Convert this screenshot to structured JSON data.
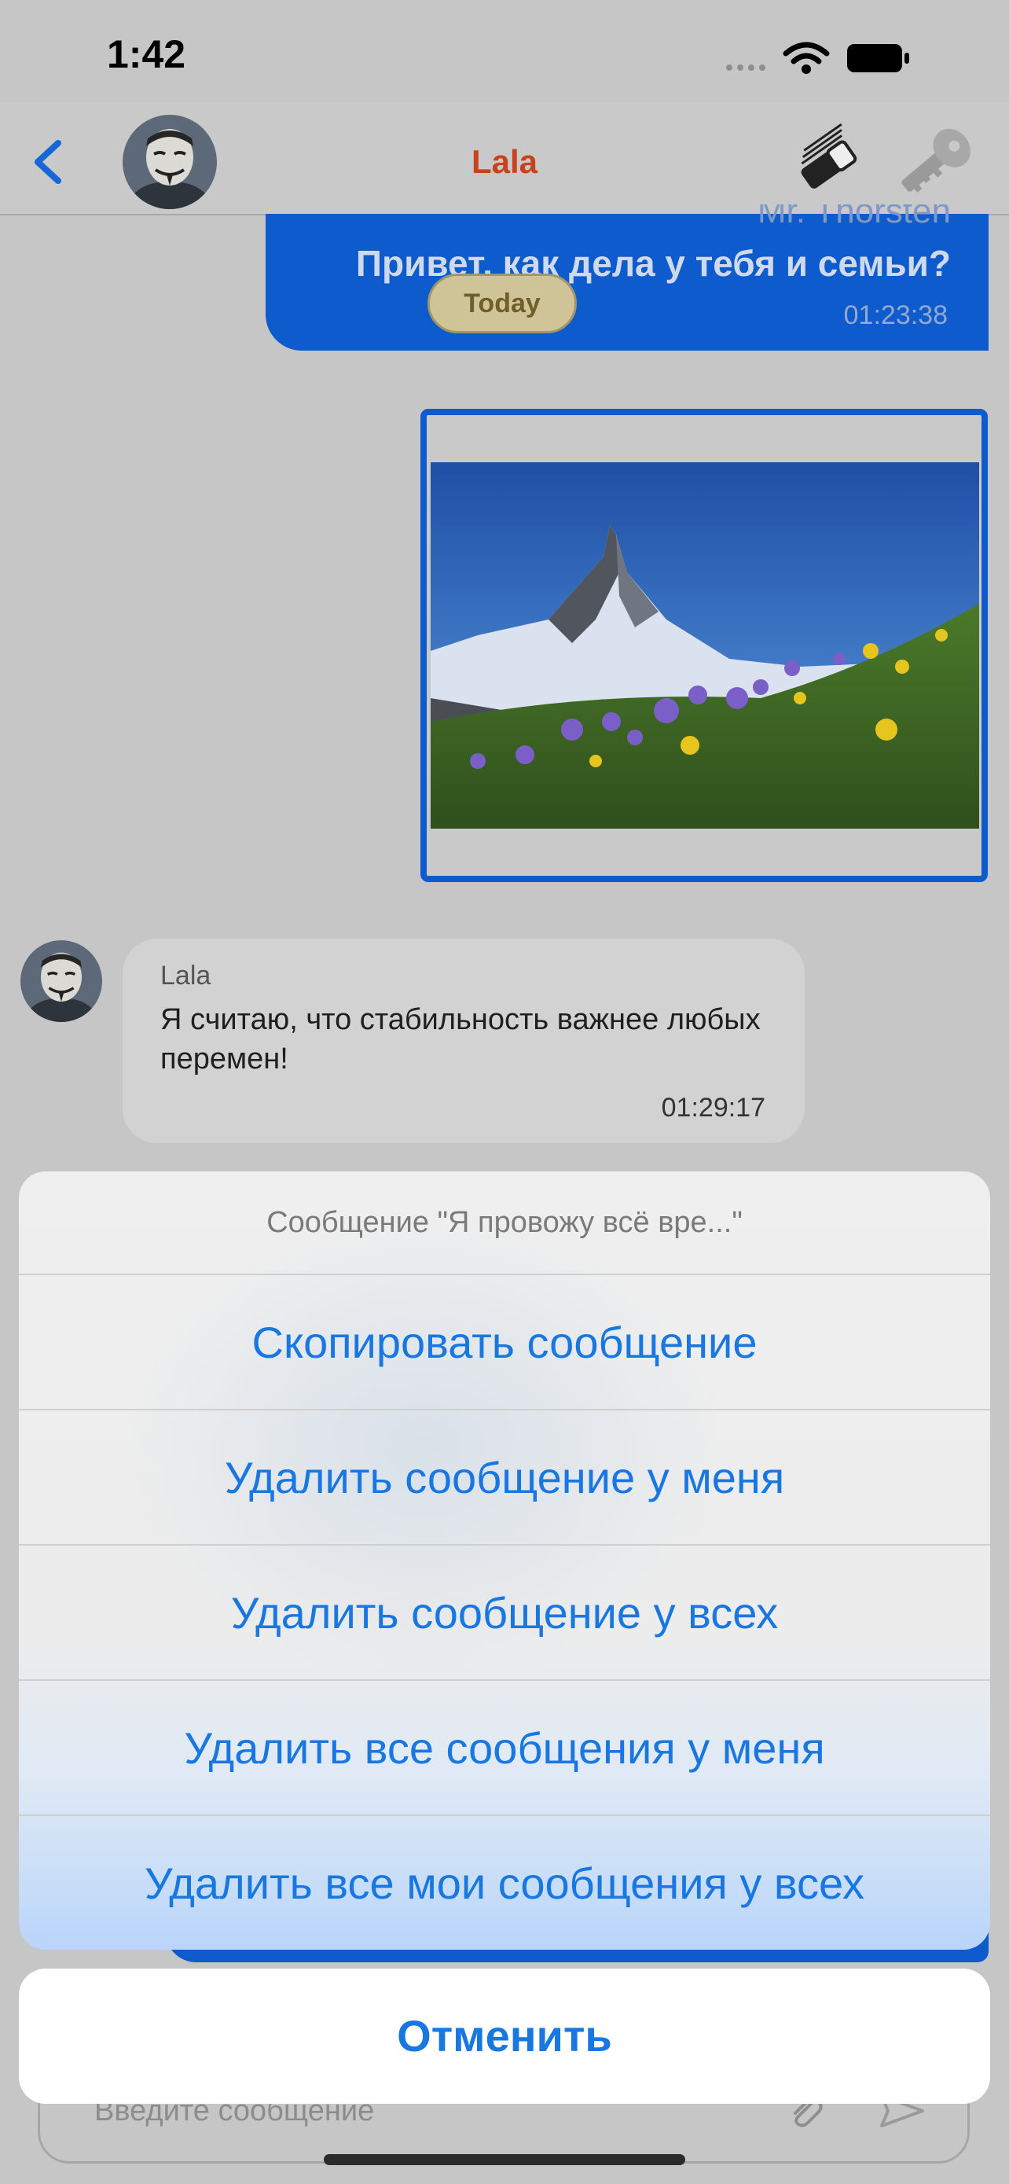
{
  "status_bar": {
    "time": "1:42"
  },
  "header": {
    "title": "Lala"
  },
  "messages": {
    "outgoing": {
      "sender": "Mr. Thorsten",
      "text": "Привет, как дела у тебя и семьи?",
      "time": "01:23:38"
    },
    "date_badge": "Today",
    "incoming": {
      "sender": "Lala",
      "text": "Я считаю, что стабильность важнее любых перемен!",
      "time": "01:29:17"
    }
  },
  "input": {
    "placeholder": "Введите сообщение"
  },
  "action_sheet": {
    "title": "Сообщение \"Я провожу всё вре...\"",
    "items": [
      "Скопировать сообщение",
      "Удалить сообщение у меня",
      "Удалить сообщение у всех",
      "Удалить все сообщения у меня",
      "Удалить все мои сообщения у всех"
    ],
    "cancel": "Отменить"
  },
  "colors": {
    "accent": "#1877e0",
    "bubble_out": "#0d5bcc",
    "title": "#c8431c"
  }
}
